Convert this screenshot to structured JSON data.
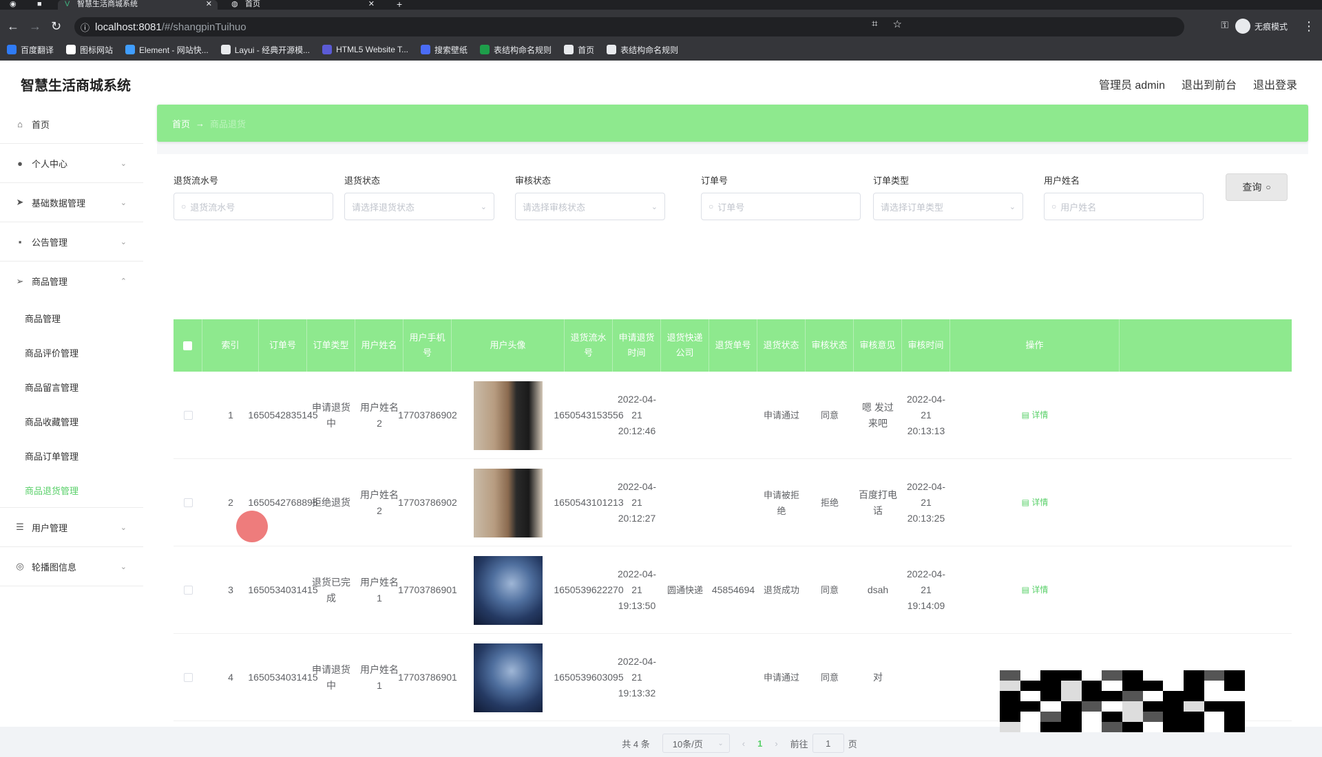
{
  "browser": {
    "tabs": [
      {
        "label": "智慧生活商城系统",
        "active": true
      },
      {
        "label": "首页",
        "active": false
      }
    ],
    "url_host": "localhost:8081",
    "url_path": "/#/shangpinTuihuo",
    "profile_label": "无痕模式",
    "bookmarks": [
      {
        "label": "百度翻译",
        "color": "#2f7bf6"
      },
      {
        "label": "图标网站",
        "color": "#ffffff"
      },
      {
        "label": "Element - 网站快...",
        "color": "#409eff"
      },
      {
        "label": "Layui - 经典开源模...",
        "color": "#e8eaed"
      },
      {
        "label": "HTML5 Website T...",
        "color": "#5b5bd6"
      },
      {
        "label": "搜索壁纸",
        "color": "#4a6cf7"
      },
      {
        "label": "表结构命名规则",
        "color": "#1e9e4a"
      },
      {
        "label": "首页",
        "color": "#e8eaed"
      },
      {
        "label": "表结构命名规则",
        "color": "#e8eaed"
      }
    ]
  },
  "header": {
    "brand": "智慧生活商城系统",
    "admin_label": "管理员 admin",
    "front_link": "退出到前台",
    "logout_link": "退出登录"
  },
  "sidebar": {
    "items": [
      {
        "label": "首页",
        "icon": "home-icon"
      },
      {
        "label": "个人中心",
        "icon": "user-icon"
      },
      {
        "label": "基础数据管理",
        "icon": "send-icon"
      },
      {
        "label": "公告管理",
        "icon": "message-icon"
      },
      {
        "label": "商品管理",
        "icon": "send-outline-icon"
      }
    ],
    "sub_items": [
      {
        "label": "商品管理",
        "active": false
      },
      {
        "label": "商品评价管理",
        "active": false
      },
      {
        "label": "商品留言管理",
        "active": false
      },
      {
        "label": "商品收藏管理",
        "active": false
      },
      {
        "label": "商品订单管理",
        "active": false
      },
      {
        "label": "商品退货管理",
        "active": true
      }
    ],
    "items_after": [
      {
        "label": "用户管理",
        "icon": "sliders-icon"
      },
      {
        "label": "轮播图信息",
        "icon": "compass-icon"
      }
    ]
  },
  "breadcrumb": {
    "home": "首页",
    "arrow": "→",
    "current": "商品退货"
  },
  "search": {
    "fields": [
      {
        "label": "退货流水号",
        "placeholder": "退货流水号",
        "type": "input"
      },
      {
        "label": "退货状态",
        "placeholder": "请选择退货状态",
        "type": "select"
      },
      {
        "label": "审核状态",
        "placeholder": "请选择审核状态",
        "type": "select"
      },
      {
        "label": "订单号",
        "placeholder": "订单号",
        "type": "input"
      },
      {
        "label": "订单类型",
        "placeholder": "请选择订单类型",
        "type": "select"
      },
      {
        "label": "用户姓名",
        "placeholder": "用户姓名",
        "type": "input"
      }
    ],
    "query_label": "查询"
  },
  "table": {
    "headers": [
      "索引",
      "订单号",
      "订单类型",
      "用户姓名",
      "用户手机号",
      "用户头像",
      "退货流水号",
      "申请退货时间",
      "退货快递公司",
      "退货单号",
      "退货状态",
      "审核状态",
      "审核意见",
      "审核时间",
      "操作"
    ],
    "rows": [
      {
        "index": "1",
        "order_no": "1650542835145",
        "order_type": "申请退货中",
        "user_name": "用户姓名2",
        "phone": "17703786902",
        "avatar": "portrait-painting",
        "return_no": "1650543153556",
        "apply_time": "2022-04-21 20:12:46",
        "express": "",
        "express_no": "",
        "return_status": "申请通过",
        "audit_status": "同意",
        "audit_opinion": "嗯 发过来吧",
        "audit_time": "2022-04-21 20:13:13",
        "action": "详情"
      },
      {
        "index": "2",
        "order_no": "1650542768895",
        "order_type": "拒绝退货",
        "user_name": "用户姓名2",
        "phone": "17703786902",
        "avatar": "portrait-painting",
        "return_no": "1650543101213",
        "apply_time": "2022-04-21 20:12:27",
        "express": "",
        "express_no": "",
        "return_status": "申请被拒绝",
        "audit_status": "拒绝",
        "audit_opinion": "百度打电话",
        "audit_time": "2022-04-21 20:13:25",
        "action": "详情"
      },
      {
        "index": "3",
        "order_no": "1650534031415",
        "order_type": "退货已完成",
        "user_name": "用户姓名1",
        "phone": "17703786901",
        "avatar": "anime-portrait",
        "return_no": "1650539622270",
        "apply_time": "2022-04-21 19:13:50",
        "express": "圆通快递",
        "express_no": "45854694",
        "return_status": "退货成功",
        "audit_status": "同意",
        "audit_opinion": "dsah",
        "audit_time": "2022-04-21 19:14:09",
        "action": "详情"
      },
      {
        "index": "4",
        "order_no": "1650534031415",
        "order_type": "申请退货中",
        "user_name": "用户姓名1",
        "phone": "17703786901",
        "avatar": "anime-portrait",
        "return_no": "1650539603095",
        "apply_time": "2022-04-21 19:13:32",
        "express": "",
        "express_no": "",
        "return_status": "申请通过",
        "audit_status": "同意",
        "audit_opinion": "对",
        "audit_time": "",
        "action": ""
      }
    ]
  },
  "pagination": {
    "total": "共 4 条",
    "page_size": "10条/页",
    "current_page": "1",
    "goto_prefix": "前往",
    "goto_value": "1",
    "goto_suffix": "页"
  },
  "colors": {
    "accent_green": "#8ee98e",
    "active_text": "#5ad06a"
  }
}
